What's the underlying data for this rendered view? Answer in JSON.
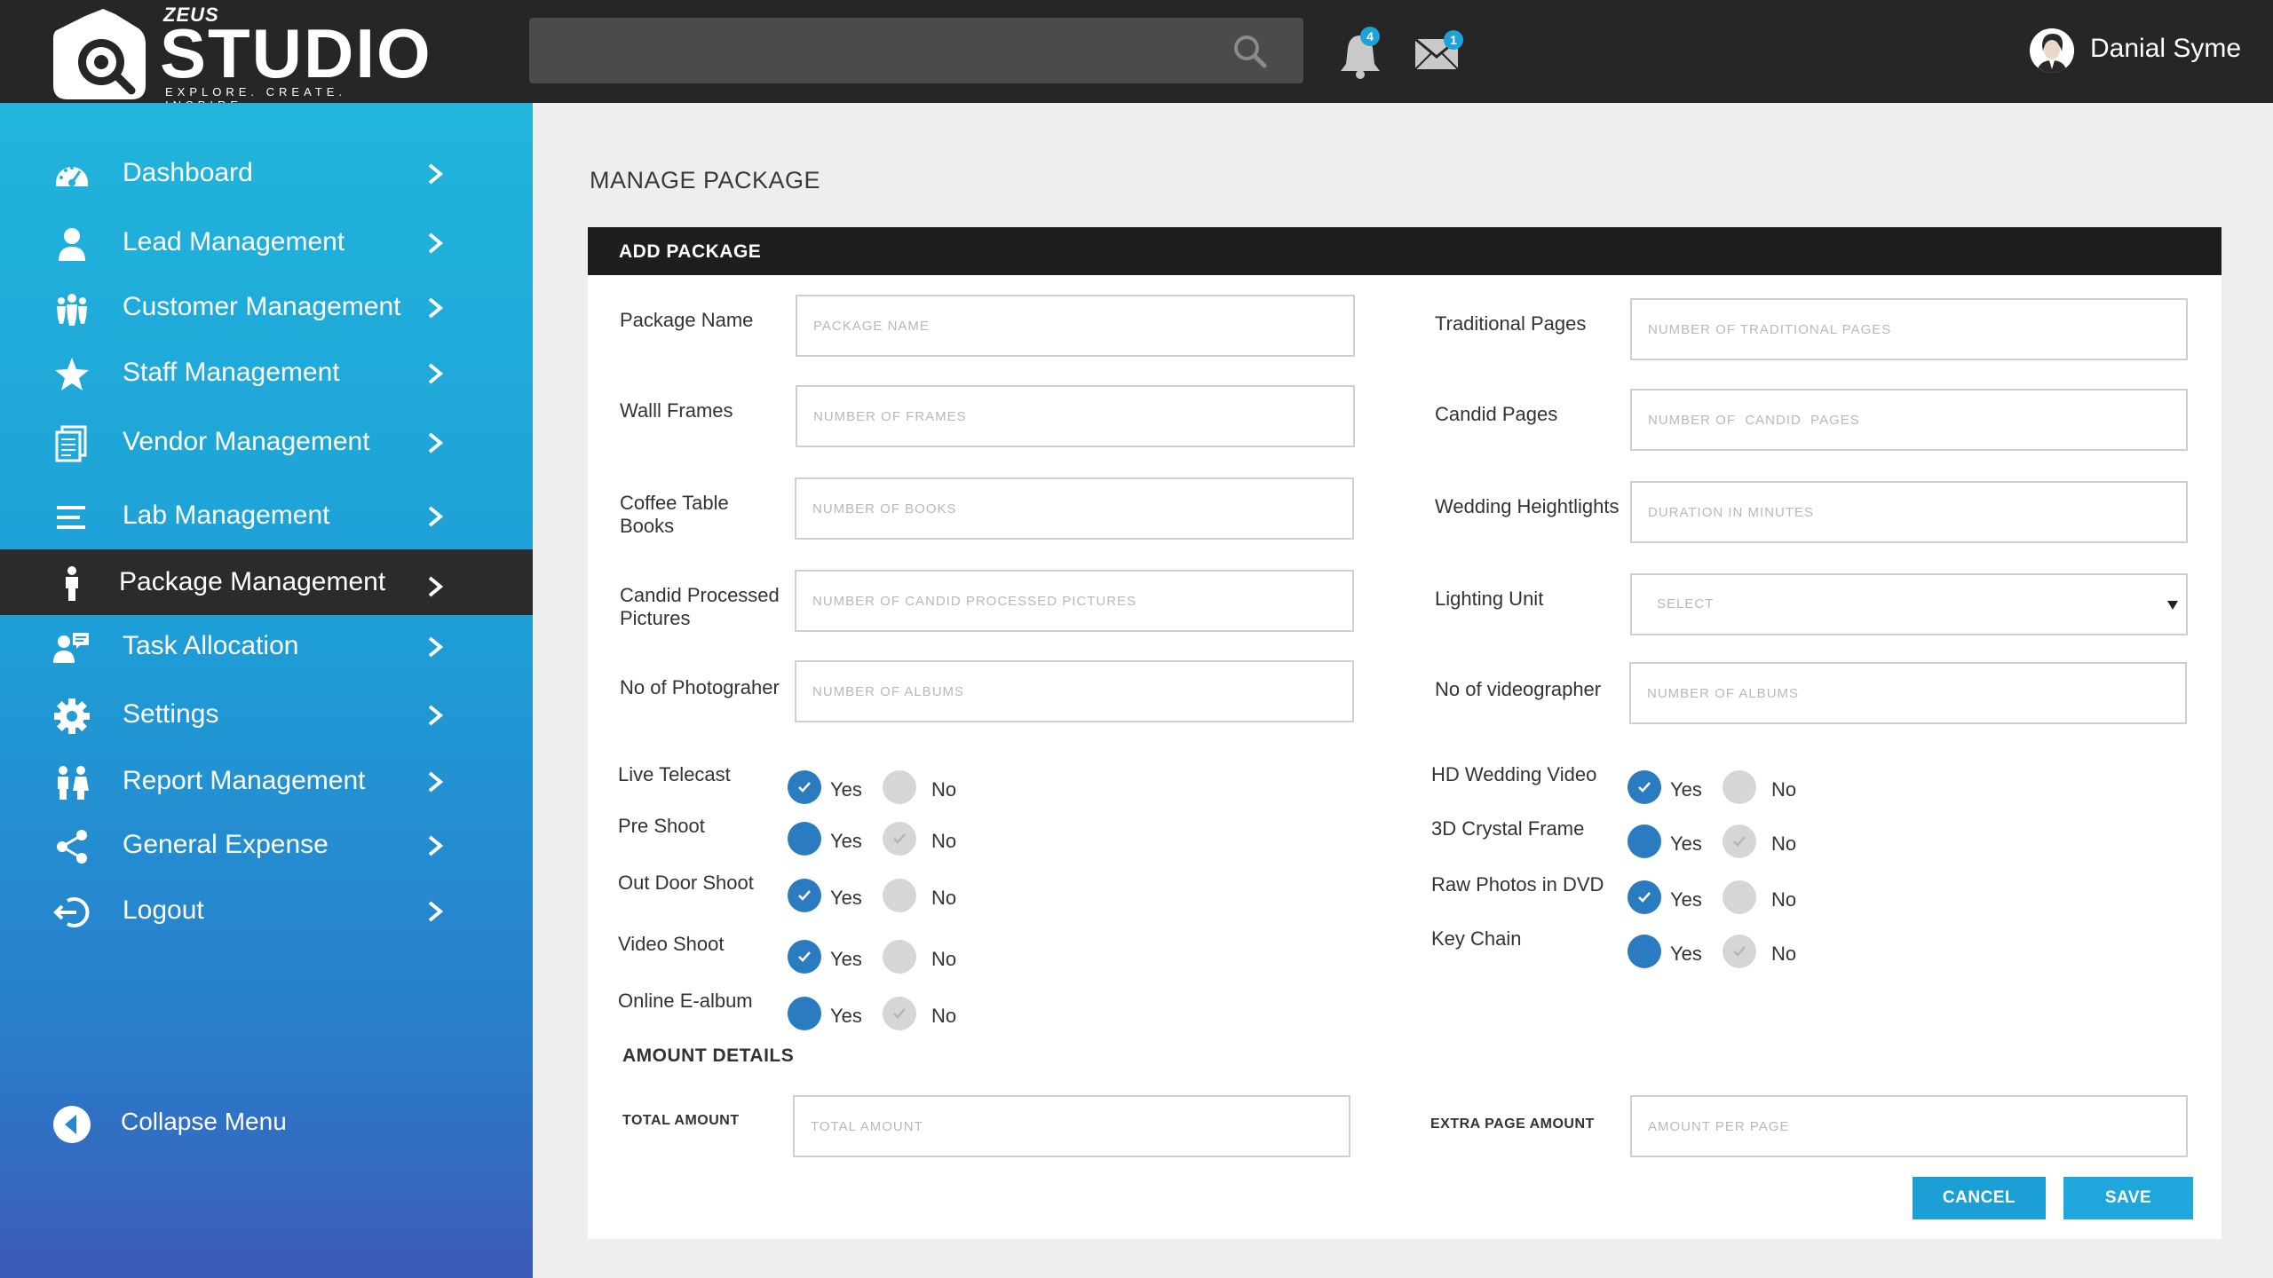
{
  "header": {
    "logo_top": "ZEUS",
    "logo_main": "STUDIO",
    "logo_tagline": "EXPLORE. CREATE. INSPIRE",
    "notifications_count": "4",
    "messages_count": "1",
    "user_name": "Danial Syme"
  },
  "sidebar": {
    "items": [
      {
        "label": "Dashboard"
      },
      {
        "label": "Lead Management"
      },
      {
        "label": "Customer Management"
      },
      {
        "label": "Staff Management"
      },
      {
        "label": "Vendor Management"
      },
      {
        "label": "Lab Management"
      },
      {
        "label": "Package Management"
      },
      {
        "label": "Task Allocation"
      },
      {
        "label": "Settings"
      },
      {
        "label": "Report Management"
      },
      {
        "label": "General Expense"
      },
      {
        "label": "Logout"
      }
    ],
    "active_index": 6,
    "collapse_label": "Collapse Menu"
  },
  "page": {
    "title": "MANAGE PACKAGE",
    "panel_title": "ADD PACKAGE"
  },
  "form": {
    "package_name": {
      "label": "Package Name",
      "placeholder": "PACKAGE NAME"
    },
    "wall_frames": {
      "label": "Walll Frames",
      "placeholder": "NUMBER OF FRAMES"
    },
    "coffee_table_books": {
      "label": "Coffee Table Books",
      "placeholder": "NUMBER OF BOOKS"
    },
    "candid_processed": {
      "label": "Candid Processed Pictures",
      "placeholder": "NUMBER OF CANDID PROCESSED PICTURES"
    },
    "photographers": {
      "label": "No of Photograher",
      "placeholder": "NUMBER OF ALBUMS"
    },
    "traditional_pages": {
      "label": "Traditional Pages",
      "placeholder": "NUMBER OF TRADITIONAL PAGES"
    },
    "candid_pages": {
      "label": "Candid Pages",
      "placeholder": "NUMBER OF  CANDID  PAGES"
    },
    "wedding_highlights": {
      "label": "Wedding Heightlights",
      "placeholder": "DURATION IN MINUTES"
    },
    "lighting_unit": {
      "label": "Lighting Unit",
      "value": "SELECT"
    },
    "videographers": {
      "label": "No of videographer",
      "placeholder": "NUMBER OF ALBUMS"
    }
  },
  "options": {
    "yes_label": "Yes",
    "no_label": "No",
    "left": [
      {
        "label": "Live Telecast",
        "selected": "yes"
      },
      {
        "label": "Pre Shoot",
        "selected": "no"
      },
      {
        "label": "Out Door Shoot",
        "selected": "yes"
      },
      {
        "label": "Video Shoot",
        "selected": "yes"
      },
      {
        "label": "Online E-album",
        "selected": "no"
      }
    ],
    "right": [
      {
        "label": "HD Wedding Video",
        "selected": "yes"
      },
      {
        "label": "3D Crystal Frame",
        "selected": "no"
      },
      {
        "label": "Raw Photos in DVD",
        "selected": "yes"
      },
      {
        "label": "Key Chain",
        "selected": "no"
      }
    ]
  },
  "amount": {
    "section_title": "AMOUNT DETAILS",
    "total_label": "TOTAL AMOUNT",
    "total_placeholder": "TOTAL AMOUNT",
    "extra_label": "EXTRA PAGE AMOUNT",
    "extra_placeholder": "AMOUNT PER PAGE"
  },
  "buttons": {
    "cancel": "CANCEL",
    "save": "SAVE"
  },
  "colors": {
    "accent": "#1fa6dd",
    "radio_selected": "#2a7bc0",
    "topbar": "#262626",
    "active_nav": "#2b2b2b"
  }
}
